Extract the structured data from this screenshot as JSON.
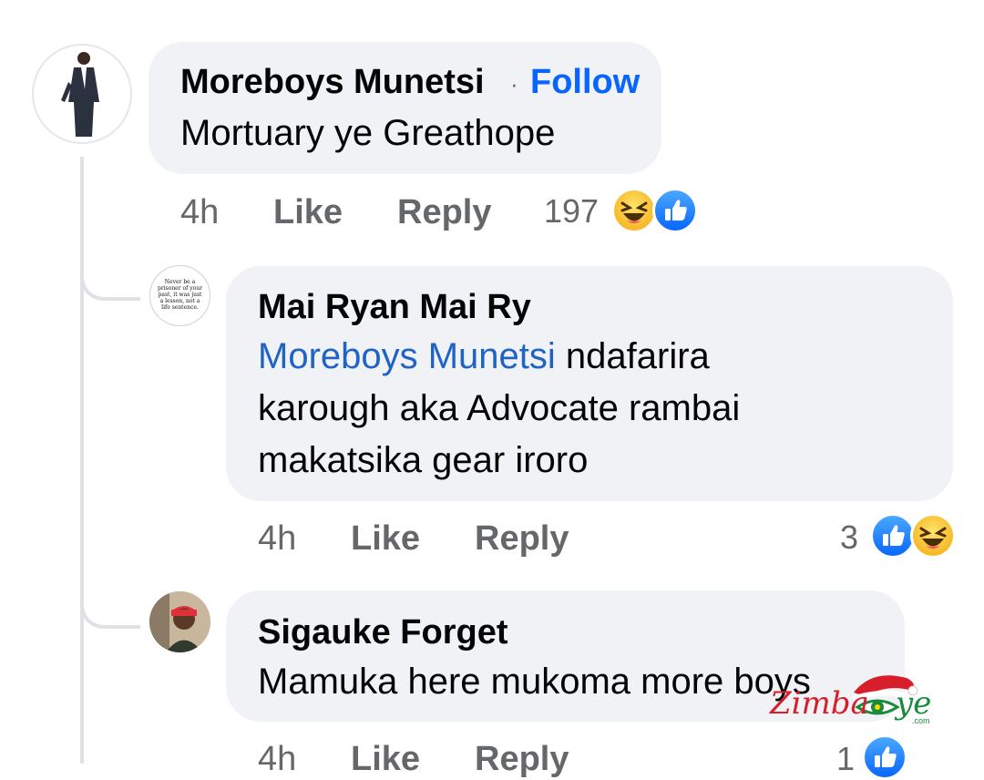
{
  "comments": [
    {
      "author": "Moreboys Munetsi",
      "follow_label": "Follow",
      "text": "Mortuary ye Greathope",
      "time": "4h",
      "like_label": "Like",
      "reply_label": "Reply",
      "reaction_count": "197",
      "reactions": [
        "haha-icon",
        "like-icon"
      ]
    }
  ],
  "replies": [
    {
      "author": "Mai Ryan Mai Ry",
      "mention": "Moreboys Munetsi",
      "text_line1_rest": " ndafarira",
      "text_line2": "karough aka Advocate rambai",
      "text_line3": "makatsika gear iroro",
      "avatar_text": "Never be a prisoner of your past, it was just a lesson, not a life sentence.",
      "time": "4h",
      "like_label": "Like",
      "reply_label": "Reply",
      "reaction_count": "3",
      "reactions": [
        "like-icon",
        "haha-icon"
      ]
    },
    {
      "author": "Sigauke Forget",
      "text": "Mamuka here mukoma more boys",
      "time": "4h",
      "like_label": "Like",
      "reply_label": "Reply",
      "reaction_count": "1",
      "reactions": [
        "like-icon"
      ]
    }
  ],
  "watermark": {
    "text_red": "Zimba",
    "text_green": "ye",
    "suffix": ".com"
  },
  "colors": {
    "bubble": "#f0f2f5",
    "mention": "#1f63c6",
    "follow": "#0866ff",
    "meta": "#65676b"
  }
}
